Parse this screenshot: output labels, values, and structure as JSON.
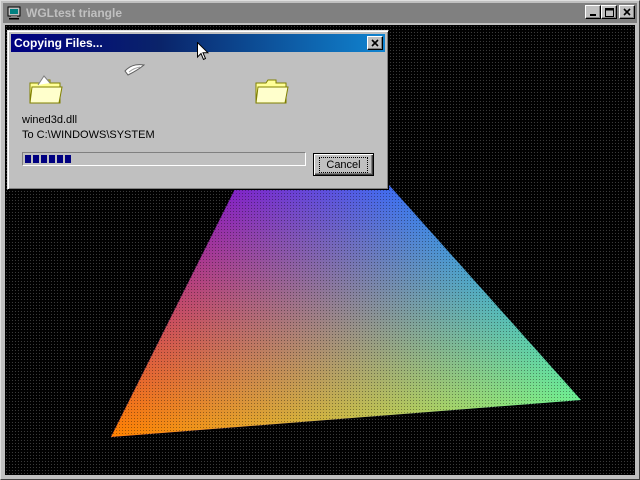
{
  "main_window": {
    "title": "WGLtest triangle",
    "app_icon": "computer-icon",
    "controls": [
      "minimize-icon",
      "maximize-icon",
      "close-icon"
    ],
    "titlebar_color": "#808080"
  },
  "dialog": {
    "title": "Copying Files...",
    "file_name": "wined3d.dll",
    "destination": "To C:\\WINDOWS\\SYSTEM",
    "progress_fraction": 0.17,
    "cancel_label": "Cancel",
    "source_icon": "folder-icon",
    "destination_icon": "folder-icon",
    "animation_icon": "flying-document-icon",
    "titlebar_color": "#000080"
  },
  "scene": {
    "type": "gouraud-shaded quad",
    "vertex_colors": [
      "#0000ff",
      "#0000ff",
      "#00ff00",
      "#ff0000"
    ]
  },
  "cursor": "arrow-cursor-icon"
}
